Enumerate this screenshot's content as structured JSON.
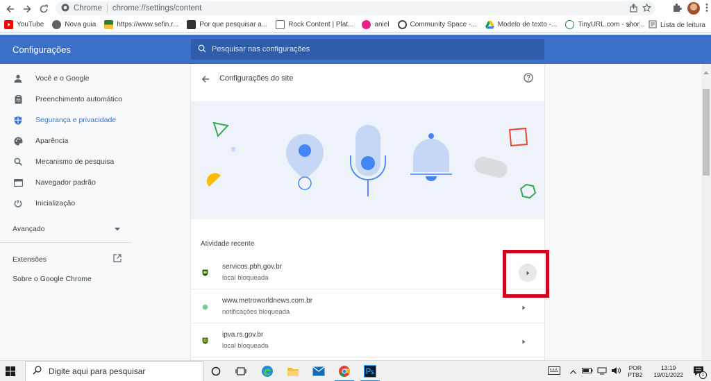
{
  "browser": {
    "site_label": "Chrome",
    "url": "chrome://settings/content"
  },
  "bookmarks": {
    "items": [
      {
        "label": "YouTube",
        "icon": "youtube-icon",
        "color": "#ff0000"
      },
      {
        "label": "Nova guia",
        "icon": "globe-icon",
        "color": "#5f6368"
      },
      {
        "label": "https://www.sefin.r...",
        "icon": "flag-icon",
        "color": "#2e7d32"
      },
      {
        "label": "Por que pesquisar a...",
        "icon": "bookmark-site-icon",
        "color": "#333333"
      },
      {
        "label": "Rock Content | Plat...",
        "icon": "bookmark-site-icon",
        "color": "#4a63b5"
      },
      {
        "label": "aniel",
        "icon": "bookmark-site-icon",
        "color": "#e91e8c"
      },
      {
        "label": "Community Space -...",
        "icon": "bookmark-site-icon",
        "color": "#444444"
      },
      {
        "label": "Modelo de texto -...",
        "icon": "drive-icon",
        "color": "#fbbc04"
      },
      {
        "label": "TinyURL.com - shor...",
        "icon": "bookmark-site-icon",
        "color": "#2d7d46"
      }
    ],
    "more": "»",
    "reading_list": "Lista de leitura"
  },
  "settings": {
    "title": "Configurações",
    "search_placeholder": "Pesquisar nas configurações"
  },
  "sidebar": {
    "items": [
      {
        "label": "Você e o Google",
        "icon": "person-icon"
      },
      {
        "label": "Preenchimento automático",
        "icon": "clipboard-icon"
      },
      {
        "label": "Segurança e privacidade",
        "icon": "shield-icon",
        "active": true
      },
      {
        "label": "Aparência",
        "icon": "palette-icon"
      },
      {
        "label": "Mecanismo de pesquisa",
        "icon": "search-icon"
      },
      {
        "label": "Navegador padrão",
        "icon": "browser-window-icon"
      },
      {
        "label": "Inicialização",
        "icon": "power-icon"
      }
    ],
    "advanced": "Avançado",
    "extensions": "Extensões",
    "about": "Sobre o Google Chrome"
  },
  "main": {
    "page_title": "Configurações do site",
    "recent_label": "Atividade recente",
    "rows": [
      {
        "domain": "servicos.pbh.gov.br",
        "status": "local bloqueada",
        "icon": "pbh-favicon-icon"
      },
      {
        "domain": "www.metroworldnews.com.br",
        "status": "notificações bloqueada",
        "icon": "metro-favicon-icon"
      },
      {
        "domain": "ipva.rs.gov.br",
        "status": "local bloqueada",
        "icon": "rs-favicon-icon"
      }
    ]
  },
  "colors": {
    "accent": "#3c70c9",
    "highlight": "#d0021b"
  },
  "taskbar": {
    "search_placeholder": "Digite aqui para pesquisar",
    "lang_top": "POR",
    "lang_bottom": "PTB2",
    "time": "13:19",
    "date": "19/01/2022",
    "notification_count": "1"
  }
}
